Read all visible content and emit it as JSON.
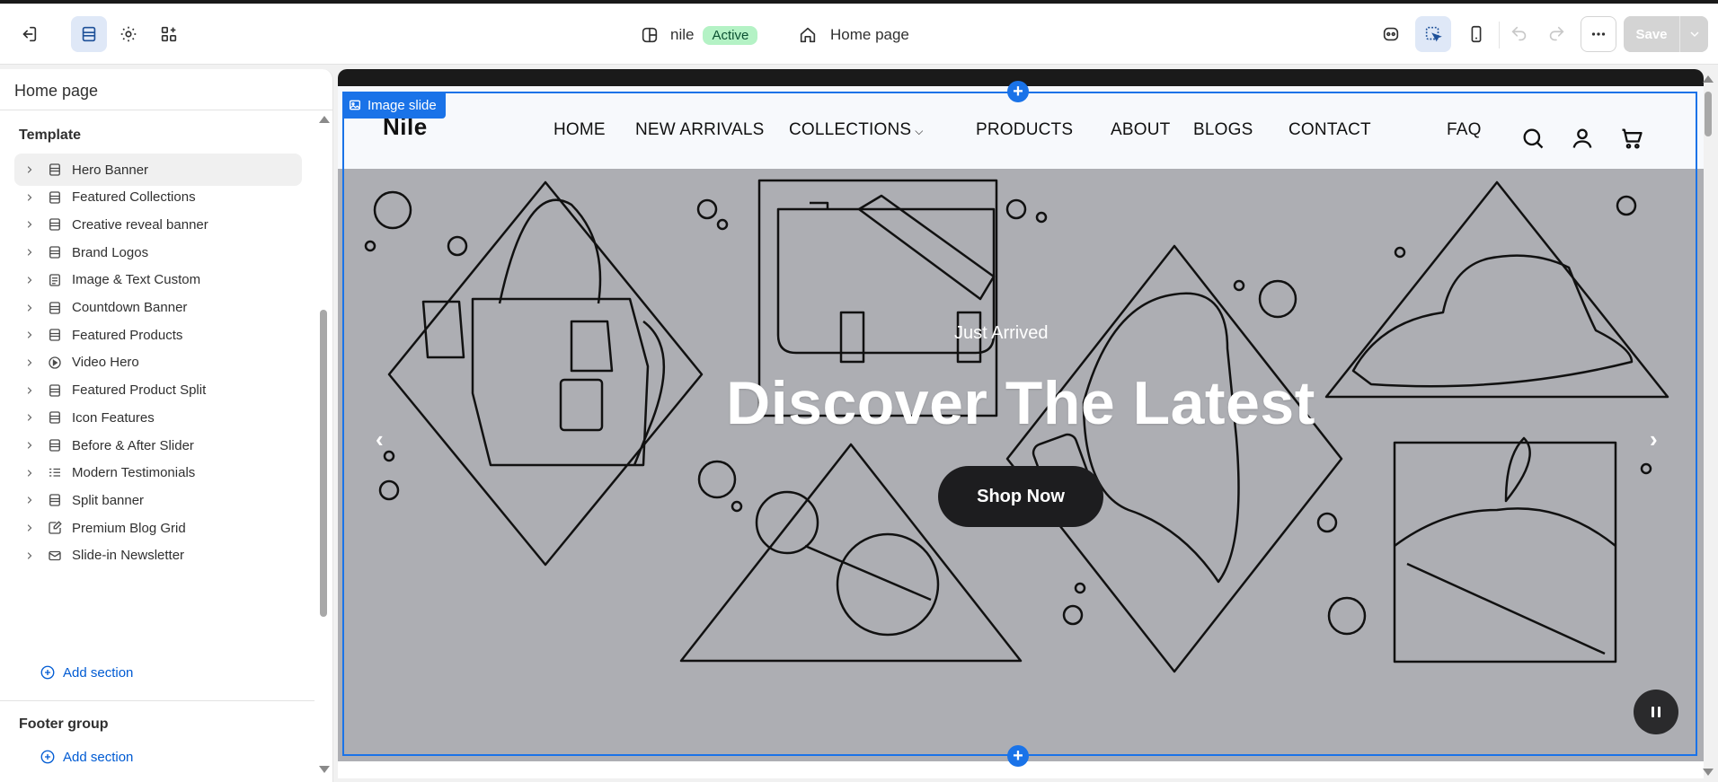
{
  "topbar": {
    "store_name": "nile",
    "status_badge": "Active",
    "page_name": "Home page",
    "save_label": "Save",
    "icons": [
      "exit-icon",
      "sections-icon",
      "settings-icon",
      "apps-icon",
      "store-icon",
      "home-icon",
      "ai-icon",
      "inspector-icon",
      "mobile-icon",
      "undo-icon",
      "redo-icon",
      "more-icon"
    ]
  },
  "sidebar": {
    "title": "Home page",
    "template_title": "Template",
    "items": [
      {
        "label": "Hero Banner",
        "icon": "section-icon"
      },
      {
        "label": "Featured Collections",
        "icon": "section-icon"
      },
      {
        "label": "Creative reveal banner",
        "icon": "section-icon"
      },
      {
        "label": "Brand Logos",
        "icon": "section-icon"
      },
      {
        "label": "Image & Text Custom",
        "icon": "text-section-icon"
      },
      {
        "label": "Countdown Banner",
        "icon": "section-icon"
      },
      {
        "label": "Featured Products",
        "icon": "section-icon"
      },
      {
        "label": "Video Hero",
        "icon": "play-icon"
      },
      {
        "label": "Featured Product Split",
        "icon": "section-icon"
      },
      {
        "label": "Icon Features",
        "icon": "section-icon"
      },
      {
        "label": "Before & After Slider",
        "icon": "section-icon"
      },
      {
        "label": "Modern Testimonials",
        "icon": "list-icon"
      },
      {
        "label": "Split banner",
        "icon": "section-icon"
      },
      {
        "label": "Premium Blog Grid",
        "icon": "edit-doc-icon"
      },
      {
        "label": "Slide-in Newsletter",
        "icon": "mail-icon"
      }
    ],
    "add_section": "Add section",
    "footer_title": "Footer group",
    "footer_add_section": "Add section"
  },
  "preview": {
    "logo": "Nile",
    "nav": [
      "HOME",
      "NEW ARRIVALS",
      "COLLECTIONS",
      "PRODUCTS",
      "ABOUT",
      "BLOGS",
      "CONTACT",
      "FAQ"
    ],
    "selection_label": "Image slide",
    "hero": {
      "eyebrow": "Just Arrived",
      "title": "Discover The Latest",
      "button": "Shop Now",
      "prev": "‹",
      "next": "›"
    },
    "colors": {
      "accent": "#1a73e8",
      "hero_bg": "#adaeb3",
      "button_bg": "#1d1d1f"
    }
  }
}
